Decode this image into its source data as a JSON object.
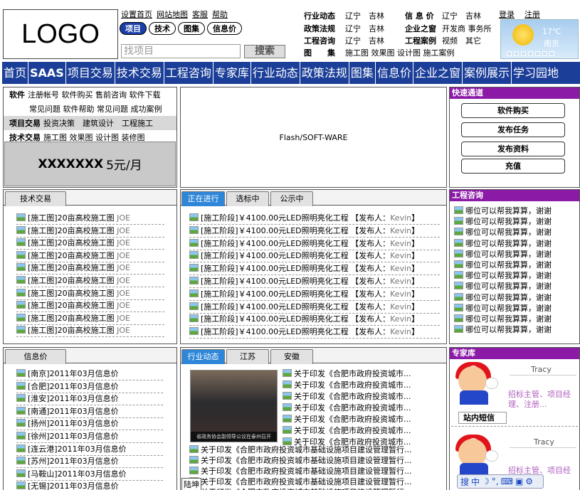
{
  "header": {
    "logo": "LOGO",
    "top_links": [
      "设置首页",
      "网站地图",
      "客服",
      "帮助"
    ],
    "search_tabs": [
      "项目",
      "技术",
      "图集",
      "信息价"
    ],
    "search_placeholder": "找项目",
    "search_button": "搜索",
    "categories_left": [
      {
        "label": "行业动态",
        "items": "辽宁　吉林"
      },
      {
        "label": "政策法规",
        "items": "辽宁　吉林"
      },
      {
        "label": "工程咨询",
        "items": "辽宁　吉林"
      },
      {
        "label": "图　　集",
        "items": "施工图 效果图 设计图 施工案例"
      }
    ],
    "categories_right": [
      {
        "label": "信 息 价",
        "items": "辽宁　吉林"
      },
      {
        "label": "企业之窗",
        "items": "开发商 事务所"
      },
      {
        "label": "工程案例",
        "items": "视频　其它"
      }
    ],
    "login": "登录",
    "register": "注册",
    "weather": {
      "temp": "17℃",
      "city": "南京"
    }
  },
  "nav": [
    "首页",
    "SAAS",
    "项目交易",
    "技术交易",
    "工程咨询",
    "专家库",
    "行业动态",
    "政策法规",
    "图集",
    "信息价",
    "企业之窗",
    "案例展示",
    "学习园地"
  ],
  "left_menu": {
    "r1_title": "软件",
    "r1_items": "注册帐号 软件购买 售前咨询 软件下载",
    "r2_items": "常见问题 软件帮助 常见问题 成功案例",
    "r3_title": "项目交易",
    "r3_items": "投资决策　建筑设计　工程施工",
    "r4_title": "技术交易",
    "r4_items": "施工图 效果图 设计图 装修图",
    "price_name": "XXXXXXX",
    "price_value": "5元/月"
  },
  "flash": "Flash/SOFT-WARE",
  "quick": {
    "title": "快速通道",
    "buttons": [
      "软件购买",
      "发布任务",
      "发布资料",
      "充值"
    ]
  },
  "tech": {
    "tab": "技术交易",
    "item_prefix": "[施工图]",
    "item_text": "20亩高校施工图",
    "item_user": "JOE"
  },
  "projects": {
    "tabs": [
      "正在进行",
      "选标中",
      "公示中"
    ],
    "item_prefix": "[施工阶段]",
    "item_text": "￥4100.00元LED照明亮化工程",
    "item_pub": "【发布人：",
    "item_user": "Kevin",
    "item_close": "】"
  },
  "consult": {
    "title": "工程咨询",
    "item": "哪位可以帮我算算，谢谢"
  },
  "info_price": {
    "tab": "信息价",
    "items": [
      "[南京]",
      "[合肥]",
      "[淮安]",
      "[南通]",
      "[扬州]",
      "[徐州]",
      "[连云港]",
      "[苏州]",
      "[马鞍山]",
      "[无锡]"
    ],
    "suffix": "2011年03月信息价"
  },
  "news": {
    "tabs": [
      "行业动态",
      "江苏",
      "安徽"
    ],
    "photo_caption": "省政务协会副领导公议在泰州召开",
    "item_short": "关于印发《合肥市政府投资城市...",
    "item_long": "关于印发《合肥市政府投资城市基础设施项目建设管理暂行...",
    "footer_tag": "陆坤"
  },
  "experts": {
    "title": "专家库",
    "name": "Tracy",
    "desc": "招标主管、项目经理、注册...",
    "desc2": "招标主管、项目经",
    "sms": "站内短信"
  }
}
